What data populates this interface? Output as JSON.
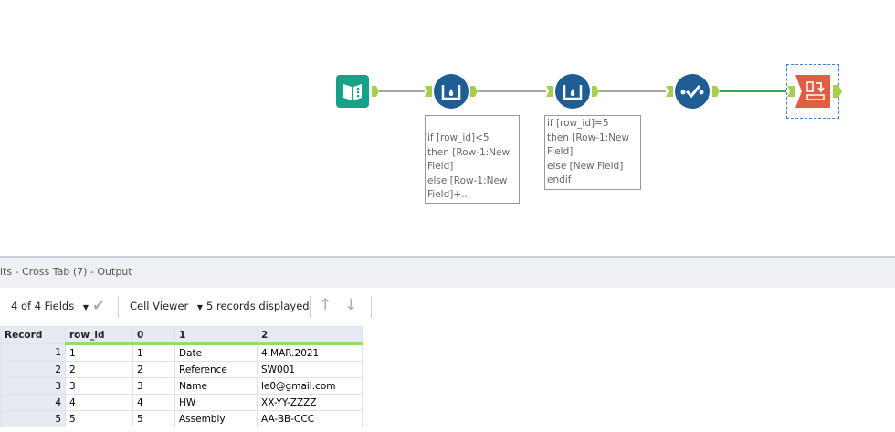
{
  "workflow": {
    "annotations": [
      [
        "if [row_id]<5",
        "then [Row-1:New",
        "Field]",
        "else [Row-1:New",
        "Field]+..."
      ],
      [
        "if [row_id]=5",
        "then [Row-1:New",
        "Field]",
        "else [New Field]",
        "endif"
      ]
    ],
    "colors": {
      "input": "#17a08a",
      "formula": "#1f5d95",
      "crosstab": "#dd5f45",
      "anchor": "#a6cf4e",
      "connection_active": "#3aa655"
    }
  },
  "results": {
    "title": "lts - Cross Tab (7) - Output",
    "toolbar": {
      "fields": "4 of 4 Fields",
      "viewer": "Cell Viewer",
      "records": "5 records displayed"
    },
    "columns": [
      "Record",
      "row_id",
      "0",
      "1",
      "2"
    ],
    "rows": [
      [
        "1",
        "1",
        "1",
        "Date",
        "4.MAR.2021"
      ],
      [
        "2",
        "2",
        "2",
        "Reference",
        "SW001"
      ],
      [
        "3",
        "3",
        "3",
        "Name",
        "le0@gmail.com"
      ],
      [
        "4",
        "4",
        "4",
        "HW",
        "XX-YY-ZZZZ"
      ],
      [
        "5",
        "5",
        "5",
        "Assembly",
        "AA-BB-CCC"
      ]
    ]
  }
}
